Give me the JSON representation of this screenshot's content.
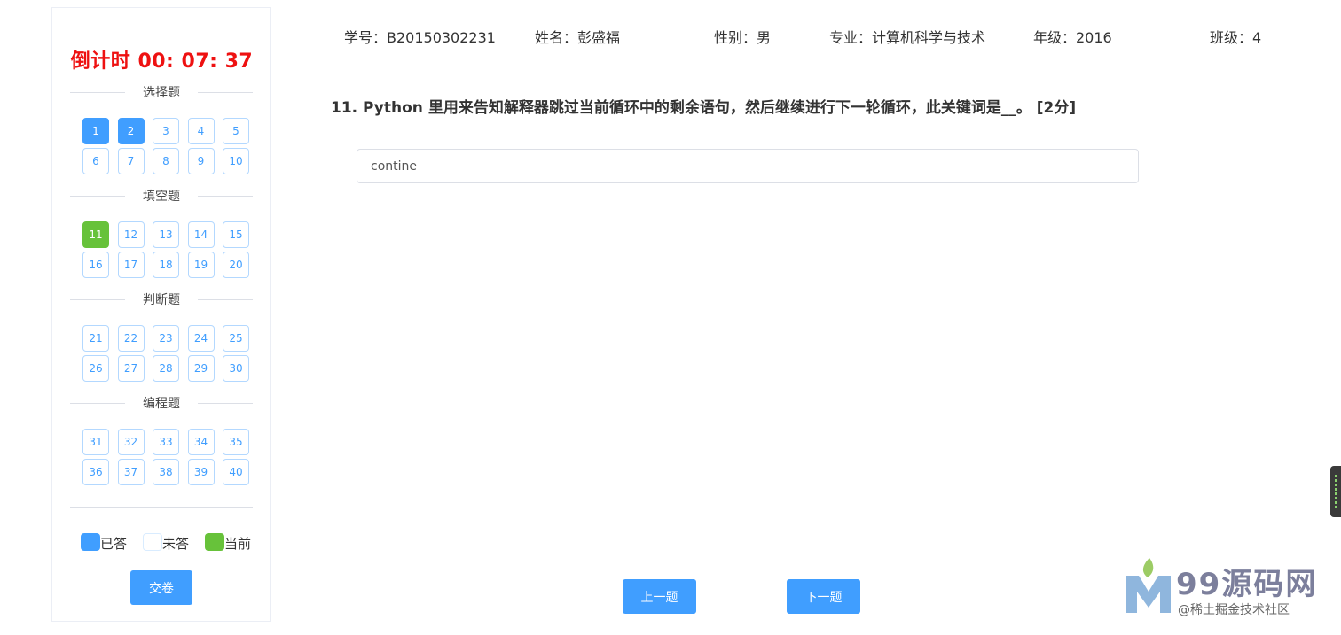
{
  "timer": {
    "label": "倒计时 00: 07: 37"
  },
  "sections": [
    {
      "title": "选择题",
      "items": [
        {
          "n": "1",
          "state": "answered"
        },
        {
          "n": "2",
          "state": "answered"
        },
        {
          "n": "3",
          "state": "unanswered"
        },
        {
          "n": "4",
          "state": "unanswered"
        },
        {
          "n": "5",
          "state": "unanswered"
        },
        {
          "n": "6",
          "state": "unanswered"
        },
        {
          "n": "7",
          "state": "unanswered"
        },
        {
          "n": "8",
          "state": "unanswered"
        },
        {
          "n": "9",
          "state": "unanswered"
        },
        {
          "n": "10",
          "state": "unanswered"
        }
      ]
    },
    {
      "title": "填空题",
      "items": [
        {
          "n": "11",
          "state": "current"
        },
        {
          "n": "12",
          "state": "unanswered"
        },
        {
          "n": "13",
          "state": "unanswered"
        },
        {
          "n": "14",
          "state": "unanswered"
        },
        {
          "n": "15",
          "state": "unanswered"
        },
        {
          "n": "16",
          "state": "unanswered"
        },
        {
          "n": "17",
          "state": "unanswered"
        },
        {
          "n": "18",
          "state": "unanswered"
        },
        {
          "n": "19",
          "state": "unanswered"
        },
        {
          "n": "20",
          "state": "unanswered"
        }
      ]
    },
    {
      "title": "判断题",
      "items": [
        {
          "n": "21",
          "state": "unanswered"
        },
        {
          "n": "22",
          "state": "unanswered"
        },
        {
          "n": "23",
          "state": "unanswered"
        },
        {
          "n": "24",
          "state": "unanswered"
        },
        {
          "n": "25",
          "state": "unanswered"
        },
        {
          "n": "26",
          "state": "unanswered"
        },
        {
          "n": "27",
          "state": "unanswered"
        },
        {
          "n": "28",
          "state": "unanswered"
        },
        {
          "n": "29",
          "state": "unanswered"
        },
        {
          "n": "30",
          "state": "unanswered"
        }
      ]
    },
    {
      "title": "编程题",
      "items": [
        {
          "n": "31",
          "state": "unanswered"
        },
        {
          "n": "32",
          "state": "unanswered"
        },
        {
          "n": "33",
          "state": "unanswered"
        },
        {
          "n": "34",
          "state": "unanswered"
        },
        {
          "n": "35",
          "state": "unanswered"
        },
        {
          "n": "36",
          "state": "unanswered"
        },
        {
          "n": "37",
          "state": "unanswered"
        },
        {
          "n": "38",
          "state": "unanswered"
        },
        {
          "n": "39",
          "state": "unanswered"
        },
        {
          "n": "40",
          "state": "unanswered"
        }
      ]
    }
  ],
  "legend": {
    "answered": "已答",
    "unanswered": "未答",
    "current": "当前"
  },
  "submit_label": "交卷",
  "student": {
    "id": "学号：B20150302231",
    "name": "姓名：彭盛福",
    "gender": "性别：男",
    "major": "专业：计算机科学与技术",
    "grade": "年级：2016",
    "class": "班级：4"
  },
  "question": {
    "text": "11. Python 里用来告知解释器跳过当前循环中的剩余语句，然后继续进行下一轮循环，此关键词是__。 [2分]",
    "answer_value": "contine"
  },
  "nav": {
    "prev_label": "上一题",
    "next_label": "下一题"
  },
  "watermark": {
    "brand": "99源码网",
    "sub": "@稀土掘金技术社区"
  },
  "colors": {
    "answered": "#409eff",
    "current": "#67c23a",
    "timer": "#ee1111"
  }
}
